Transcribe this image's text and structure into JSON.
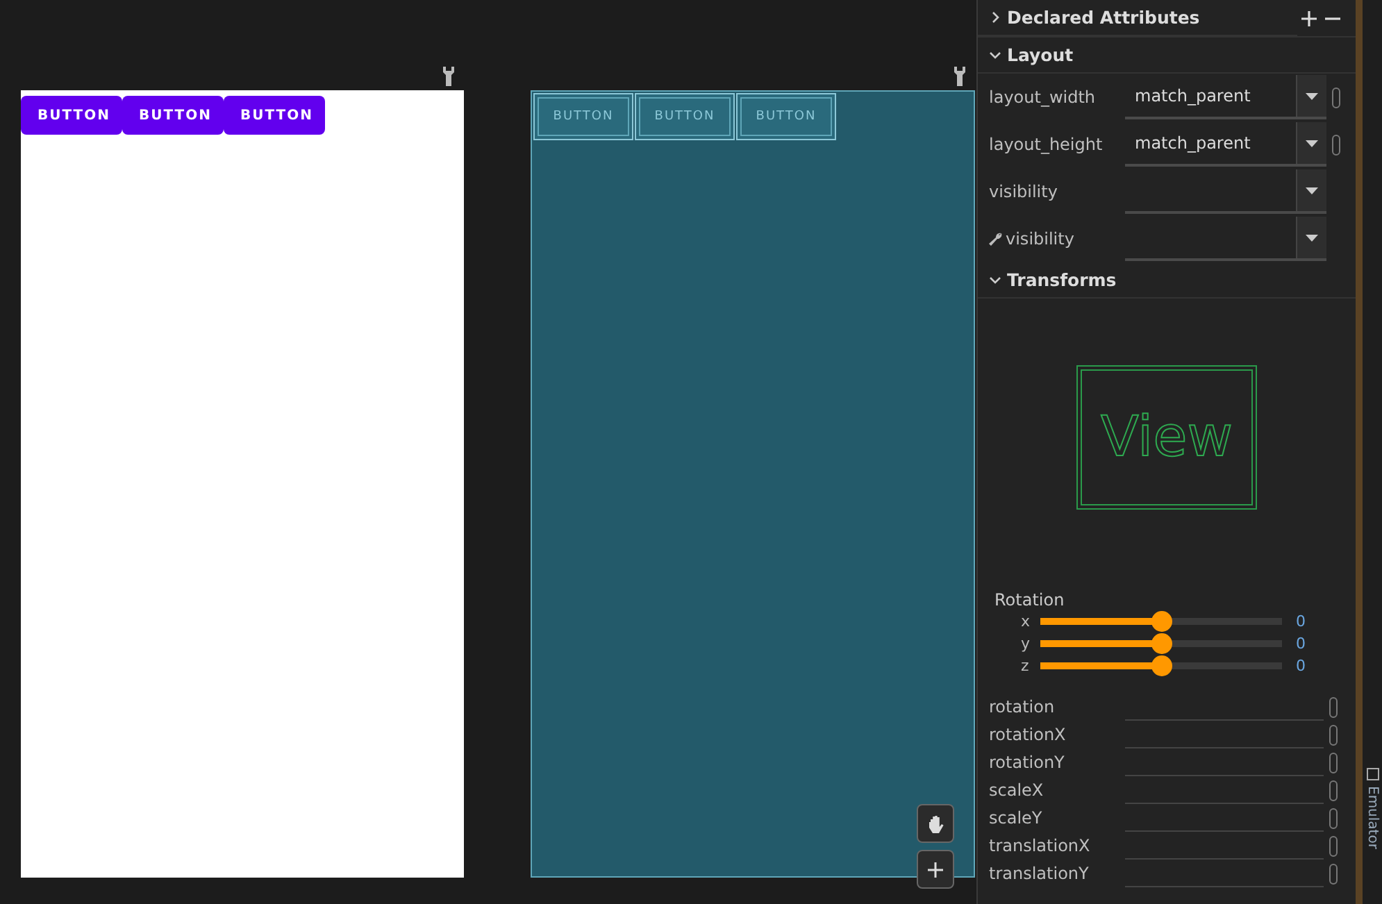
{
  "canvas": {
    "design_buttons": [
      "BUTTON",
      "BUTTON",
      "BUTTON"
    ],
    "blueprint_buttons": [
      "BUTTON",
      "BUTTON",
      "BUTTON"
    ]
  },
  "attributes": {
    "declared": {
      "title": "Declared Attributes",
      "expanded": false
    },
    "layout": {
      "title": "Layout",
      "expanded": true,
      "rows": [
        {
          "label": "layout_width",
          "value": "match_parent",
          "tools_attribute": false,
          "has_reference": true
        },
        {
          "label": "layout_height",
          "value": "match_parent",
          "tools_attribute": false,
          "has_reference": true
        },
        {
          "label": "visibility",
          "tools_attribute": false,
          "has_reference": false
        },
        {
          "label": "visibility",
          "tools_attribute": true,
          "has_reference": false
        }
      ]
    },
    "transforms": {
      "title": "Transforms",
      "expanded": true,
      "preview_label": "View",
      "rotation": {
        "title": "Rotation",
        "axes": [
          {
            "axis": "x",
            "level": 0.5,
            "reading": "0"
          },
          {
            "axis": "y",
            "level": 0.5,
            "reading": "0"
          },
          {
            "axis": "z",
            "level": 0.5,
            "reading": "0"
          }
        ]
      },
      "fields": [
        "rotation",
        "rotationX",
        "rotationY",
        "scaleX",
        "scaleY",
        "translationX",
        "translationY"
      ]
    }
  },
  "side_strip": {
    "label": "Emulator"
  }
}
